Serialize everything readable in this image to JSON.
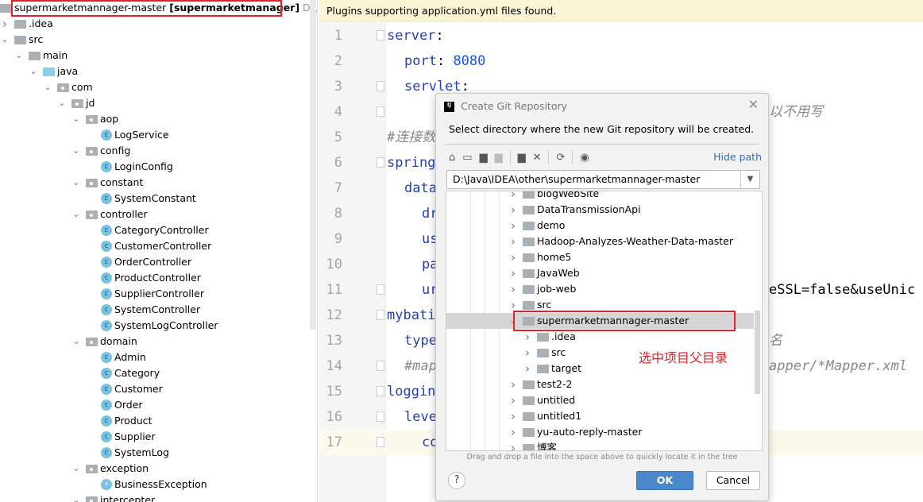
{
  "project_tree": {
    "root": {
      "name": "supermarketmannager-master",
      "module": "[supermarketmanager]",
      "path": "D:\\Java\\IDEA\\"
    },
    "items": [
      {
        "label": ".idea",
        "level": 1,
        "type": "folder",
        "expanded": false
      },
      {
        "label": "src",
        "level": 1,
        "type": "folder",
        "expanded": true
      },
      {
        "label": "main",
        "level": 2,
        "type": "folder",
        "expanded": true
      },
      {
        "label": "java",
        "level": 3,
        "type": "source-folder",
        "expanded": true
      },
      {
        "label": "com",
        "level": 4,
        "type": "package",
        "expanded": true
      },
      {
        "label": "jd",
        "level": 5,
        "type": "package",
        "expanded": true
      },
      {
        "label": "aop",
        "level": 6,
        "type": "package",
        "expanded": true
      },
      {
        "label": "LogService",
        "level": 7,
        "type": "class"
      },
      {
        "label": "config",
        "level": 6,
        "type": "package",
        "expanded": true
      },
      {
        "label": "LoginConfig",
        "level": 7,
        "type": "class"
      },
      {
        "label": "constant",
        "level": 6,
        "type": "package",
        "expanded": true
      },
      {
        "label": "SystemConstant",
        "level": 7,
        "type": "class"
      },
      {
        "label": "controller",
        "level": 6,
        "type": "package",
        "expanded": true
      },
      {
        "label": "CategoryController",
        "level": 7,
        "type": "class"
      },
      {
        "label": "CustomerController",
        "level": 7,
        "type": "class"
      },
      {
        "label": "OrderController",
        "level": 7,
        "type": "class"
      },
      {
        "label": "ProductController",
        "level": 7,
        "type": "class"
      },
      {
        "label": "SupplierController",
        "level": 7,
        "type": "class"
      },
      {
        "label": "SystemController",
        "level": 7,
        "type": "class"
      },
      {
        "label": "SystemLogController",
        "level": 7,
        "type": "class"
      },
      {
        "label": "domain",
        "level": 6,
        "type": "package",
        "expanded": true
      },
      {
        "label": "Admin",
        "level": 7,
        "type": "class"
      },
      {
        "label": "Category",
        "level": 7,
        "type": "class"
      },
      {
        "label": "Customer",
        "level": 7,
        "type": "class"
      },
      {
        "label": "Order",
        "level": 7,
        "type": "class"
      },
      {
        "label": "Product",
        "level": 7,
        "type": "class"
      },
      {
        "label": "Supplier",
        "level": 7,
        "type": "class"
      },
      {
        "label": "SystemLog",
        "level": 7,
        "type": "class"
      },
      {
        "label": "exception",
        "level": 6,
        "type": "package",
        "expanded": true
      },
      {
        "label": "BusinessException",
        "level": 7,
        "type": "exception"
      },
      {
        "label": "intercepter",
        "level": 6,
        "type": "package",
        "expanded": true
      }
    ]
  },
  "editor": {
    "banner": "Plugins supporting application.yml files found.",
    "current_line": 17,
    "lines": [
      {
        "n": "1",
        "indent": 0,
        "key": "server",
        "rest": ":",
        "right": ""
      },
      {
        "n": "2",
        "indent": 1,
        "key": "port",
        "rest": ": ",
        "val": "8080",
        "right": ""
      },
      {
        "n": "3",
        "indent": 1,
        "key": "servlet",
        "rest": ":",
        "right": ""
      },
      {
        "n": "4",
        "indent": 2,
        "key": "",
        "rest": "",
        "right": "以不用写",
        "right_comment": true
      },
      {
        "n": "5",
        "indent": 0,
        "comment": "#连接数",
        "right": ""
      },
      {
        "n": "6",
        "indent": 0,
        "key": "spring",
        "rest": "",
        "right": ""
      },
      {
        "n": "7",
        "indent": 1,
        "key": "data",
        "rest": "",
        "right": ""
      },
      {
        "n": "8",
        "indent": 2,
        "key": "dr",
        "rest": "",
        "right": ""
      },
      {
        "n": "9",
        "indent": 2,
        "key": "us",
        "rest": "",
        "right": ""
      },
      {
        "n": "10",
        "indent": 2,
        "key": "pa",
        "rest": "",
        "right": ""
      },
      {
        "n": "11",
        "indent": 2,
        "key": "ur",
        "rest": "",
        "right": "eSSL=false&useUnic"
      },
      {
        "n": "12",
        "indent": 0,
        "key": "mybati",
        "rest": "",
        "right": ""
      },
      {
        "n": "13",
        "indent": 1,
        "key": "type",
        "rest": "",
        "right": "名",
        "right_comment": true
      },
      {
        "n": "14",
        "indent": 1,
        "comment": "#map",
        "right": "apper/*Mapper.xml",
        "right_comment": true
      },
      {
        "n": "15",
        "indent": 0,
        "key": "loggin",
        "rest": "",
        "right": ""
      },
      {
        "n": "16",
        "indent": 1,
        "key": "leve",
        "rest": "",
        "right": ""
      },
      {
        "n": "17",
        "indent": 2,
        "key": "co",
        "rest": "",
        "right": ""
      }
    ]
  },
  "dialog": {
    "title": "Create Git Repository",
    "logo": "IJ",
    "description": "Select directory where the new Git repository will be created.",
    "hide_path": "Hide path",
    "path": "D:\\Java\\IDEA\\other\\supermarketmannager-master",
    "toolbar_icons": [
      "home-icon",
      "desktop-icon",
      "project-folder-icon",
      "module-folder-icon",
      "new-folder-icon",
      "delete-icon",
      "refresh-icon",
      "show-hidden-icon"
    ],
    "tree": [
      {
        "label": "blogWebSite",
        "level": 0
      },
      {
        "label": "DataTransmissionApi",
        "level": 0
      },
      {
        "label": "demo",
        "level": 0
      },
      {
        "label": "Hadoop-Analyzes-Weather-Data-master",
        "level": 0
      },
      {
        "label": "home5",
        "level": 0
      },
      {
        "label": "JavaWeb",
        "level": 0
      },
      {
        "label": "job-web",
        "level": 0
      },
      {
        "label": "src",
        "level": 0
      },
      {
        "label": "supermarketmannager-master",
        "level": 0,
        "selected": true,
        "expanded": true
      },
      {
        "label": ".idea",
        "level": 1
      },
      {
        "label": "src",
        "level": 1
      },
      {
        "label": "target",
        "level": 1
      },
      {
        "label": "test2-2",
        "level": 0
      },
      {
        "label": "untitled",
        "level": 0
      },
      {
        "label": "untitled1",
        "level": 0
      },
      {
        "label": "yu-auto-reply-master",
        "level": 0
      },
      {
        "label": "博客",
        "level": 0
      }
    ],
    "annotation": "选中项目父目录",
    "hint": "Drag and drop a file into the space above to quickly locate it in the tree",
    "help": "?",
    "ok": "OK",
    "cancel": "Cancel"
  },
  "colors": {
    "highlight": "#e3212a",
    "accent": "#4a87cb",
    "banner": "#fbf4d5"
  }
}
